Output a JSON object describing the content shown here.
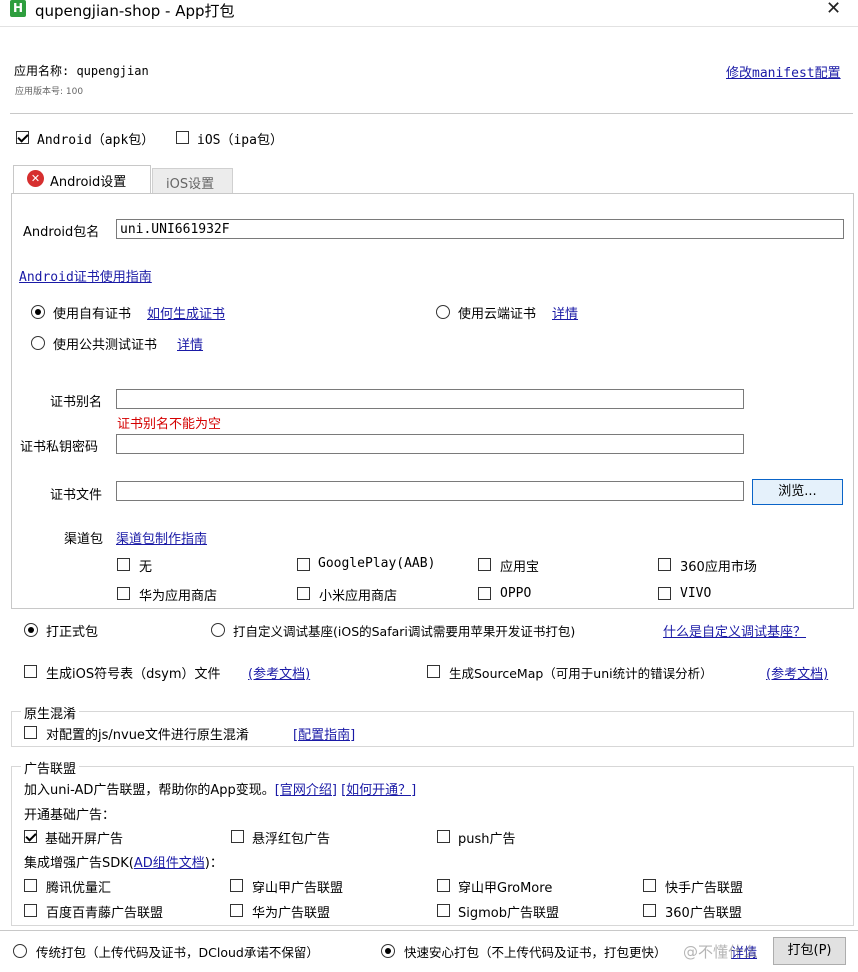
{
  "window": {
    "title": "qupengjian-shop - App打包",
    "close_glyph": "✕"
  },
  "header": {
    "app_name": "应用名称: qupengjian",
    "app_version": "应用版本号: 100",
    "manifest_link": "修改manifest配置"
  },
  "platforms": {
    "android": "Android（apk包）",
    "ios": "iOS（ipa包）",
    "android_checked": true,
    "ios_checked": false
  },
  "tabs": {
    "android": "Android设置",
    "ios": "iOS设置"
  },
  "android": {
    "package_label": "Android包名",
    "package_value": "uni.UNI661932F",
    "cert_guide": "Android证书使用指南",
    "cert_options": {
      "own": "使用自有证书",
      "own_link": "如何生成证书",
      "cloud": "使用云端证书",
      "cloud_link": "详情",
      "public": "使用公共测试证书",
      "public_link": "详情"
    },
    "alias_label": "证书别名",
    "alias_error": "证书别名不能为空",
    "password_label": "证书私钥密码",
    "file_label": "证书文件",
    "browse_button": "浏览...",
    "channel_label": "渠道包",
    "channel_link": "渠道包制作指南",
    "channels": [
      "无",
      "GooglePlay(AAB)",
      "应用宝",
      "360应用市场",
      "华为应用商店",
      "小米应用商店",
      "OPPO",
      "VIVO"
    ]
  },
  "build_type": {
    "release": "打正式包",
    "custom": "打自定义调试基座(iOS的Safari调试需要用苹果开发证书打包)",
    "custom_link": "什么是自定义调试基座？"
  },
  "options": {
    "dsym": "生成iOS符号表（dsym）文件",
    "dsym_link": "(参考文档)",
    "sourcemap": "生成SourceMap（可用于uni统计的错误分析）",
    "sourcemap_link": "(参考文档)"
  },
  "obfuscation": {
    "title": "原生混淆",
    "label": "对配置的js/nvue文件进行原生混淆",
    "link": "[配置指南]"
  },
  "ads": {
    "title": "广告联盟",
    "intro": "加入uni-AD广告联盟，帮助你的App变现。",
    "intro_link1": "[官网介绍]",
    "intro_link2": "[如何开通？]",
    "basic_title": "开通基础广告：",
    "basic": [
      {
        "label": "基础开屏广告",
        "checked": true
      },
      {
        "label": "悬浮红包广告",
        "checked": false
      },
      {
        "label": "push广告",
        "checked": false
      }
    ],
    "sdk_title_prefix": "集成增强广告SDK(",
    "sdk_title_link": "AD组件文档",
    "sdk_title_suffix": ")：",
    "sdk": [
      "腾讯优量汇",
      "穿山甲广告联盟",
      "穿山甲GroMore",
      "快手广告联盟",
      "百度百青藤广告联盟",
      "华为广告联盟",
      "Sigmob广告联盟",
      "360广告联盟"
    ]
  },
  "footer": {
    "traditional": "传统打包（上传代码及证书，DCloud承诺不保留）",
    "fast": "快速安心打包（不上传代码及证书，打包更快）",
    "fast_link": "详情",
    "pack_button": "打包(P)",
    "watermark": "@不懂什么"
  },
  "colors": {
    "accent_link": "#1a1aa6",
    "error": "#d40000",
    "app_icon": "#2e9e3e",
    "tab_error": "#d62f2f"
  }
}
